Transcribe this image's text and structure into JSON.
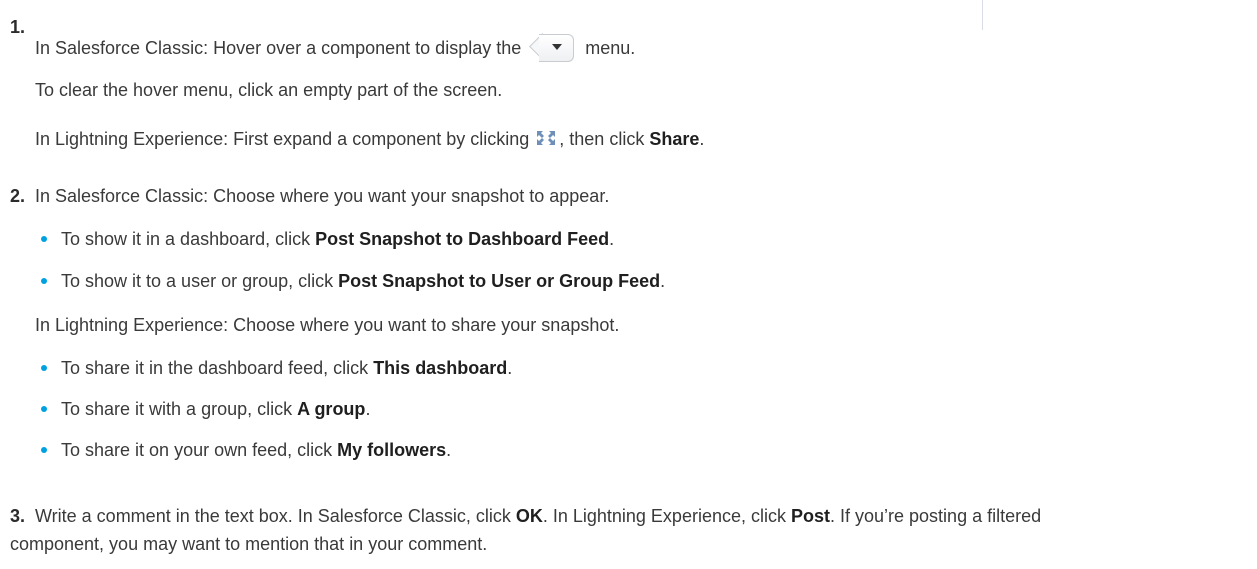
{
  "steps": [
    {
      "number": "1.",
      "classic_prefix": "In Salesforce Classic: Hover over a component to display the",
      "classic_suffix": "menu.",
      "clear_hint": "To clear the hover menu, click an empty part of the screen.",
      "lightning_prefix": "In Lightning Experience: First expand a component by clicking",
      "lightning_mid": ", then click ",
      "lightning_bold": "Share",
      "lightning_end": "."
    },
    {
      "number": "2.",
      "classic_intro": "In Salesforce Classic: Choose where you want your snapshot to appear.",
      "classic_bullets": [
        {
          "prefix": "To show it in a dashboard, click ",
          "bold": "Post Snapshot to Dashboard Feed",
          "end": "."
        },
        {
          "prefix": "To show it to a user or group, click ",
          "bold": "Post Snapshot to User or Group Feed",
          "end": "."
        }
      ],
      "lightning_intro": "In Lightning Experience: Choose where you want to share your snapshot.",
      "lightning_bullets": [
        {
          "prefix": "To share it in the dashboard feed, click ",
          "bold": "This dashboard",
          "end": "."
        },
        {
          "prefix": "To share it with a group, click ",
          "bold": "A group",
          "end": "."
        },
        {
          "prefix": "To share it on your own feed, click ",
          "bold": "My followers",
          "end": "."
        }
      ]
    },
    {
      "number": "3.",
      "p1": "Write a comment in the text box. In Salesforce Classic, click ",
      "b1": "OK",
      "p2": ". In Lightning Experience, click ",
      "b2": "Post",
      "p3": ". If you’re posting a filtered",
      "line2": "component, you may want to mention that in your comment."
    }
  ],
  "icons": {
    "menu_button": "dropdown-menu-icon",
    "expand": "expand-icon"
  },
  "colors": {
    "bullet": "#00a1e0",
    "text": "#3a3a3a"
  }
}
